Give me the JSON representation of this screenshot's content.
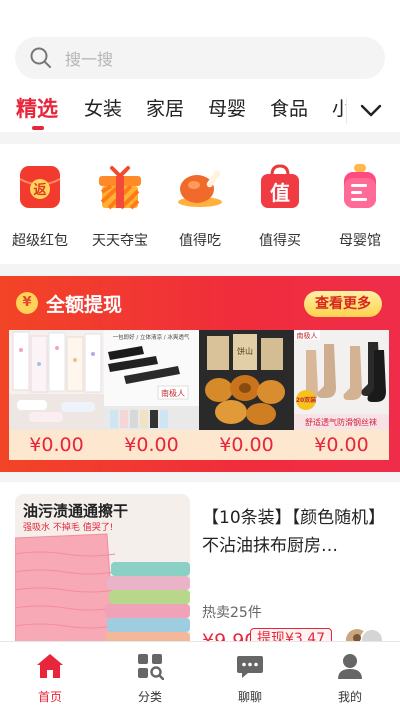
{
  "search": {
    "placeholder": "搜一搜"
  },
  "tabs": [
    "精选",
    "女装",
    "家居",
    "母婴",
    "食品",
    "小"
  ],
  "categories": [
    {
      "label": "超级红包",
      "icon": "red-envelope-icon",
      "glyph": "返"
    },
    {
      "label": "天天夺宝",
      "icon": "gift-box-icon"
    },
    {
      "label": "值得吃",
      "icon": "roast-chicken-icon"
    },
    {
      "label": "值得买",
      "icon": "shopping-bag-icon",
      "glyph": "值"
    },
    {
      "label": "母婴馆",
      "icon": "baby-bottle-icon"
    }
  ],
  "banner": {
    "icon_glyph": "¥",
    "title": "全额提现",
    "more_label": "查看更多",
    "products": [
      {
        "price": "¥0.00",
        "image": "towels-product-image"
      },
      {
        "price": "¥0.00",
        "image": "arm-sleeves-product-image",
        "brand": "南极人",
        "caption": "一包即好 / 立体清凉 / 冰爽透气"
      },
      {
        "price": "¥0.00",
        "image": "pastry-product-image",
        "caption": "饼山"
      },
      {
        "price": "¥0.00",
        "image": "socks-product-image",
        "brand": "南极人",
        "badge": "20双装",
        "caption": "舒适透气防滑钢丝袜"
      }
    ]
  },
  "item": {
    "image_caption": "油污渍通通擦干",
    "image_subcaption": "强吸水 不掉毛 值哭了!",
    "title": "【10条装】【颜色随机】不沾油抹布厨房…",
    "sales": "热卖25件",
    "price": "¥9.90",
    "cash_badge": "提现¥3.47"
  },
  "nav": [
    {
      "label": "首页",
      "icon": "home-icon",
      "active": true
    },
    {
      "label": "分类",
      "icon": "category-grid-icon",
      "active": false
    },
    {
      "label": "聊聊",
      "icon": "chat-bubble-icon",
      "active": false
    },
    {
      "label": "我的",
      "icon": "user-profile-icon",
      "active": false
    }
  ],
  "colors": {
    "accent": "#e8253a",
    "banner": "#f02d3c"
  }
}
